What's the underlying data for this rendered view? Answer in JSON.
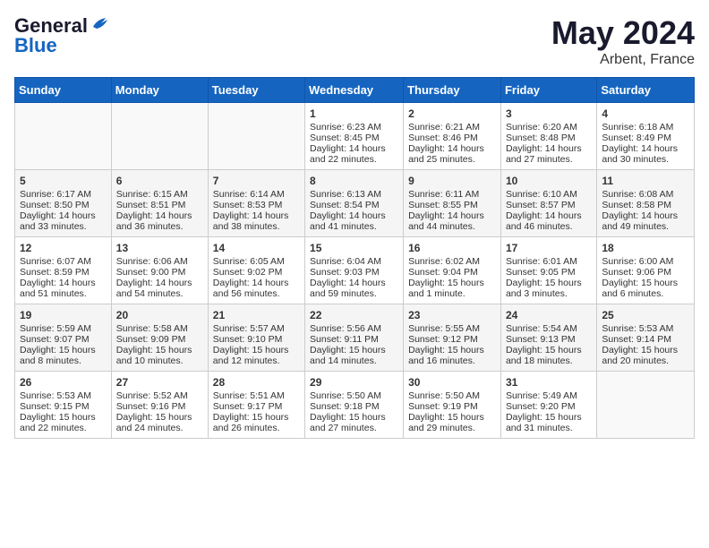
{
  "header": {
    "logo_line1": "General",
    "logo_line2": "Blue",
    "month": "May 2024",
    "location": "Arbent, France"
  },
  "weekdays": [
    "Sunday",
    "Monday",
    "Tuesday",
    "Wednesday",
    "Thursday",
    "Friday",
    "Saturday"
  ],
  "weeks": [
    [
      {
        "day": "",
        "sunrise": "",
        "sunset": "",
        "daylight": ""
      },
      {
        "day": "",
        "sunrise": "",
        "sunset": "",
        "daylight": ""
      },
      {
        "day": "",
        "sunrise": "",
        "sunset": "",
        "daylight": ""
      },
      {
        "day": "1",
        "sunrise": "Sunrise: 6:23 AM",
        "sunset": "Sunset: 8:45 PM",
        "daylight": "Daylight: 14 hours and 22 minutes."
      },
      {
        "day": "2",
        "sunrise": "Sunrise: 6:21 AM",
        "sunset": "Sunset: 8:46 PM",
        "daylight": "Daylight: 14 hours and 25 minutes."
      },
      {
        "day": "3",
        "sunrise": "Sunrise: 6:20 AM",
        "sunset": "Sunset: 8:48 PM",
        "daylight": "Daylight: 14 hours and 27 minutes."
      },
      {
        "day": "4",
        "sunrise": "Sunrise: 6:18 AM",
        "sunset": "Sunset: 8:49 PM",
        "daylight": "Daylight: 14 hours and 30 minutes."
      }
    ],
    [
      {
        "day": "5",
        "sunrise": "Sunrise: 6:17 AM",
        "sunset": "Sunset: 8:50 PM",
        "daylight": "Daylight: 14 hours and 33 minutes."
      },
      {
        "day": "6",
        "sunrise": "Sunrise: 6:15 AM",
        "sunset": "Sunset: 8:51 PM",
        "daylight": "Daylight: 14 hours and 36 minutes."
      },
      {
        "day": "7",
        "sunrise": "Sunrise: 6:14 AM",
        "sunset": "Sunset: 8:53 PM",
        "daylight": "Daylight: 14 hours and 38 minutes."
      },
      {
        "day": "8",
        "sunrise": "Sunrise: 6:13 AM",
        "sunset": "Sunset: 8:54 PM",
        "daylight": "Daylight: 14 hours and 41 minutes."
      },
      {
        "day": "9",
        "sunrise": "Sunrise: 6:11 AM",
        "sunset": "Sunset: 8:55 PM",
        "daylight": "Daylight: 14 hours and 44 minutes."
      },
      {
        "day": "10",
        "sunrise": "Sunrise: 6:10 AM",
        "sunset": "Sunset: 8:57 PM",
        "daylight": "Daylight: 14 hours and 46 minutes."
      },
      {
        "day": "11",
        "sunrise": "Sunrise: 6:08 AM",
        "sunset": "Sunset: 8:58 PM",
        "daylight": "Daylight: 14 hours and 49 minutes."
      }
    ],
    [
      {
        "day": "12",
        "sunrise": "Sunrise: 6:07 AM",
        "sunset": "Sunset: 8:59 PM",
        "daylight": "Daylight: 14 hours and 51 minutes."
      },
      {
        "day": "13",
        "sunrise": "Sunrise: 6:06 AM",
        "sunset": "Sunset: 9:00 PM",
        "daylight": "Daylight: 14 hours and 54 minutes."
      },
      {
        "day": "14",
        "sunrise": "Sunrise: 6:05 AM",
        "sunset": "Sunset: 9:02 PM",
        "daylight": "Daylight: 14 hours and 56 minutes."
      },
      {
        "day": "15",
        "sunrise": "Sunrise: 6:04 AM",
        "sunset": "Sunset: 9:03 PM",
        "daylight": "Daylight: 14 hours and 59 minutes."
      },
      {
        "day": "16",
        "sunrise": "Sunrise: 6:02 AM",
        "sunset": "Sunset: 9:04 PM",
        "daylight": "Daylight: 15 hours and 1 minute."
      },
      {
        "day": "17",
        "sunrise": "Sunrise: 6:01 AM",
        "sunset": "Sunset: 9:05 PM",
        "daylight": "Daylight: 15 hours and 3 minutes."
      },
      {
        "day": "18",
        "sunrise": "Sunrise: 6:00 AM",
        "sunset": "Sunset: 9:06 PM",
        "daylight": "Daylight: 15 hours and 6 minutes."
      }
    ],
    [
      {
        "day": "19",
        "sunrise": "Sunrise: 5:59 AM",
        "sunset": "Sunset: 9:07 PM",
        "daylight": "Daylight: 15 hours and 8 minutes."
      },
      {
        "day": "20",
        "sunrise": "Sunrise: 5:58 AM",
        "sunset": "Sunset: 9:09 PM",
        "daylight": "Daylight: 15 hours and 10 minutes."
      },
      {
        "day": "21",
        "sunrise": "Sunrise: 5:57 AM",
        "sunset": "Sunset: 9:10 PM",
        "daylight": "Daylight: 15 hours and 12 minutes."
      },
      {
        "day": "22",
        "sunrise": "Sunrise: 5:56 AM",
        "sunset": "Sunset: 9:11 PM",
        "daylight": "Daylight: 15 hours and 14 minutes."
      },
      {
        "day": "23",
        "sunrise": "Sunrise: 5:55 AM",
        "sunset": "Sunset: 9:12 PM",
        "daylight": "Daylight: 15 hours and 16 minutes."
      },
      {
        "day": "24",
        "sunrise": "Sunrise: 5:54 AM",
        "sunset": "Sunset: 9:13 PM",
        "daylight": "Daylight: 15 hours and 18 minutes."
      },
      {
        "day": "25",
        "sunrise": "Sunrise: 5:53 AM",
        "sunset": "Sunset: 9:14 PM",
        "daylight": "Daylight: 15 hours and 20 minutes."
      }
    ],
    [
      {
        "day": "26",
        "sunrise": "Sunrise: 5:53 AM",
        "sunset": "Sunset: 9:15 PM",
        "daylight": "Daylight: 15 hours and 22 minutes."
      },
      {
        "day": "27",
        "sunrise": "Sunrise: 5:52 AM",
        "sunset": "Sunset: 9:16 PM",
        "daylight": "Daylight: 15 hours and 24 minutes."
      },
      {
        "day": "28",
        "sunrise": "Sunrise: 5:51 AM",
        "sunset": "Sunset: 9:17 PM",
        "daylight": "Daylight: 15 hours and 26 minutes."
      },
      {
        "day": "29",
        "sunrise": "Sunrise: 5:50 AM",
        "sunset": "Sunset: 9:18 PM",
        "daylight": "Daylight: 15 hours and 27 minutes."
      },
      {
        "day": "30",
        "sunrise": "Sunrise: 5:50 AM",
        "sunset": "Sunset: 9:19 PM",
        "daylight": "Daylight: 15 hours and 29 minutes."
      },
      {
        "day": "31",
        "sunrise": "Sunrise: 5:49 AM",
        "sunset": "Sunset: 9:20 PM",
        "daylight": "Daylight: 15 hours and 31 minutes."
      },
      {
        "day": "",
        "sunrise": "",
        "sunset": "",
        "daylight": ""
      }
    ]
  ]
}
